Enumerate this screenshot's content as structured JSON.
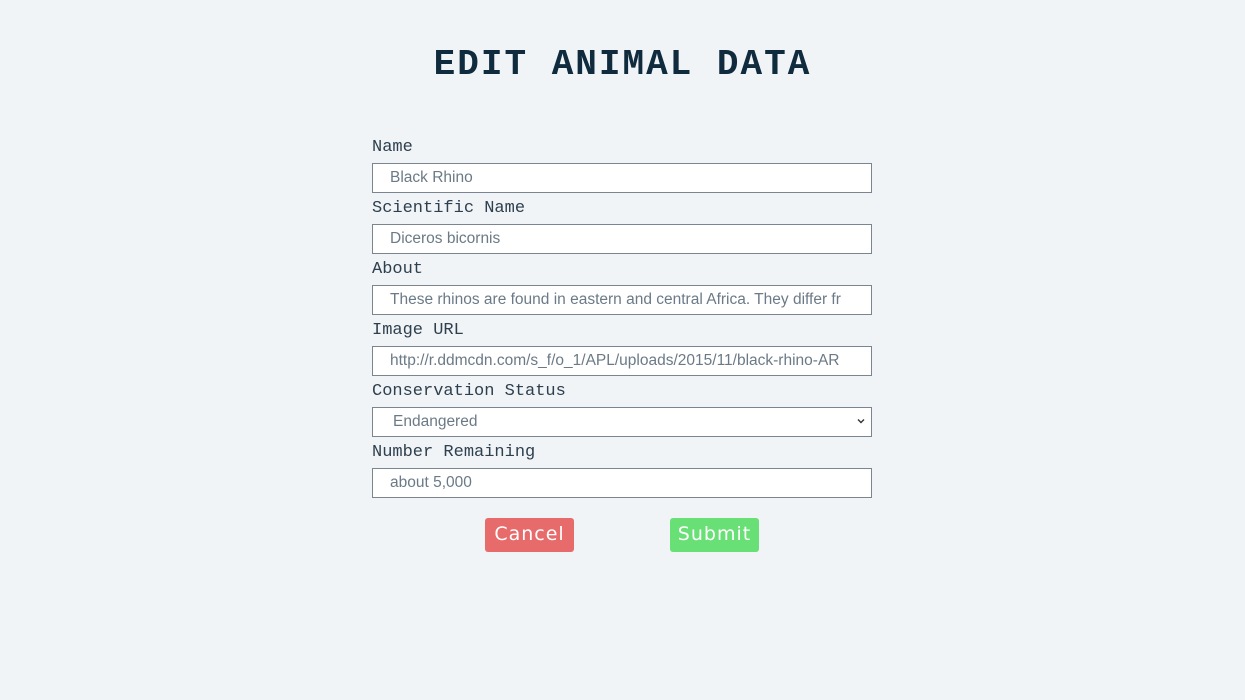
{
  "page": {
    "title": "EDIT ANIMAL DATA"
  },
  "form": {
    "name": {
      "label": "Name",
      "value": "Black Rhino"
    },
    "scientific_name": {
      "label": "Scientific Name",
      "value": "Diceros bicornis"
    },
    "about": {
      "label": "About",
      "value": "These rhinos are found in eastern and central Africa. They differ fr"
    },
    "image_url": {
      "label": "Image URL",
      "value": "http://r.ddmcdn.com/s_f/o_1/APL/uploads/2015/11/black-rhino-AR"
    },
    "conservation_status": {
      "label": "Conservation Status",
      "selected": "Endangered"
    },
    "number_remaining": {
      "label": "Number Remaining",
      "value": "about 5,000"
    }
  },
  "actions": {
    "cancel_label": "Cancel",
    "submit_label": "Submit"
  },
  "colors": {
    "background": "#f0f4f7",
    "title": "#0f2b3d",
    "cancel": "#e86b6b",
    "submit": "#69e075"
  },
  "icons": {
    "select_arrow": "chevron-down-icon"
  }
}
